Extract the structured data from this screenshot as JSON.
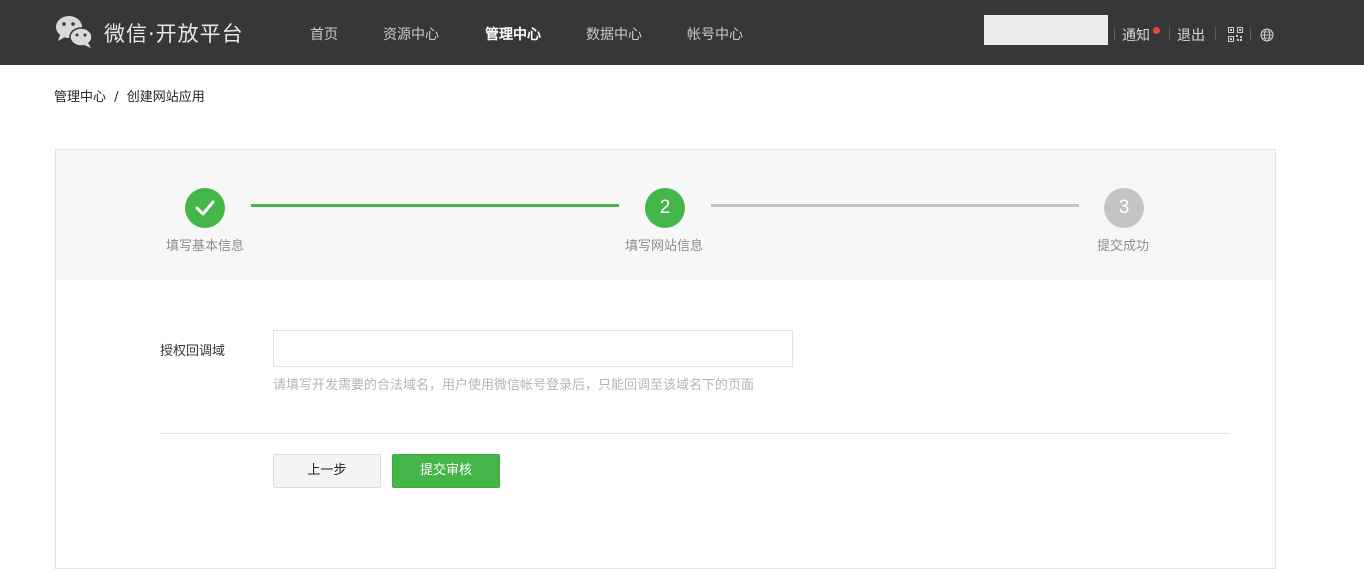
{
  "header": {
    "brand": "微信·开放平台",
    "nav": [
      {
        "label": "首页",
        "active": false
      },
      {
        "label": "资源中心",
        "active": false
      },
      {
        "label": "管理中心",
        "active": true
      },
      {
        "label": "数据中心",
        "active": false
      },
      {
        "label": "帐号中心",
        "active": false
      }
    ],
    "notify_label": "通知",
    "logout_label": "退出",
    "icons": [
      "wechat-logo-icon",
      "qrcode-icon",
      "globe-icon"
    ],
    "colors": {
      "bar_bg": "#373737",
      "notify_dot": "#e8493f"
    }
  },
  "breadcrumb": {
    "parent": "管理中心",
    "separator": "/",
    "current": "创建网站应用"
  },
  "steps": [
    {
      "index": "",
      "label": "填写基本信息",
      "state": "done"
    },
    {
      "index": "2",
      "label": "填写网站信息",
      "state": "current"
    },
    {
      "index": "3",
      "label": "提交成功",
      "state": "todo"
    }
  ],
  "form": {
    "field_label": "授权回调域",
    "field_value": "",
    "field_placeholder": "",
    "hint": "请填写开发需要的合法域名，用户使用微信帐号登录后，只能回调至该域名下的页面"
  },
  "buttons": {
    "prev_label": "上一步",
    "submit_label": "提交审核"
  },
  "colors": {
    "accent": "#44b549",
    "inactive": "#c4c4c4"
  }
}
